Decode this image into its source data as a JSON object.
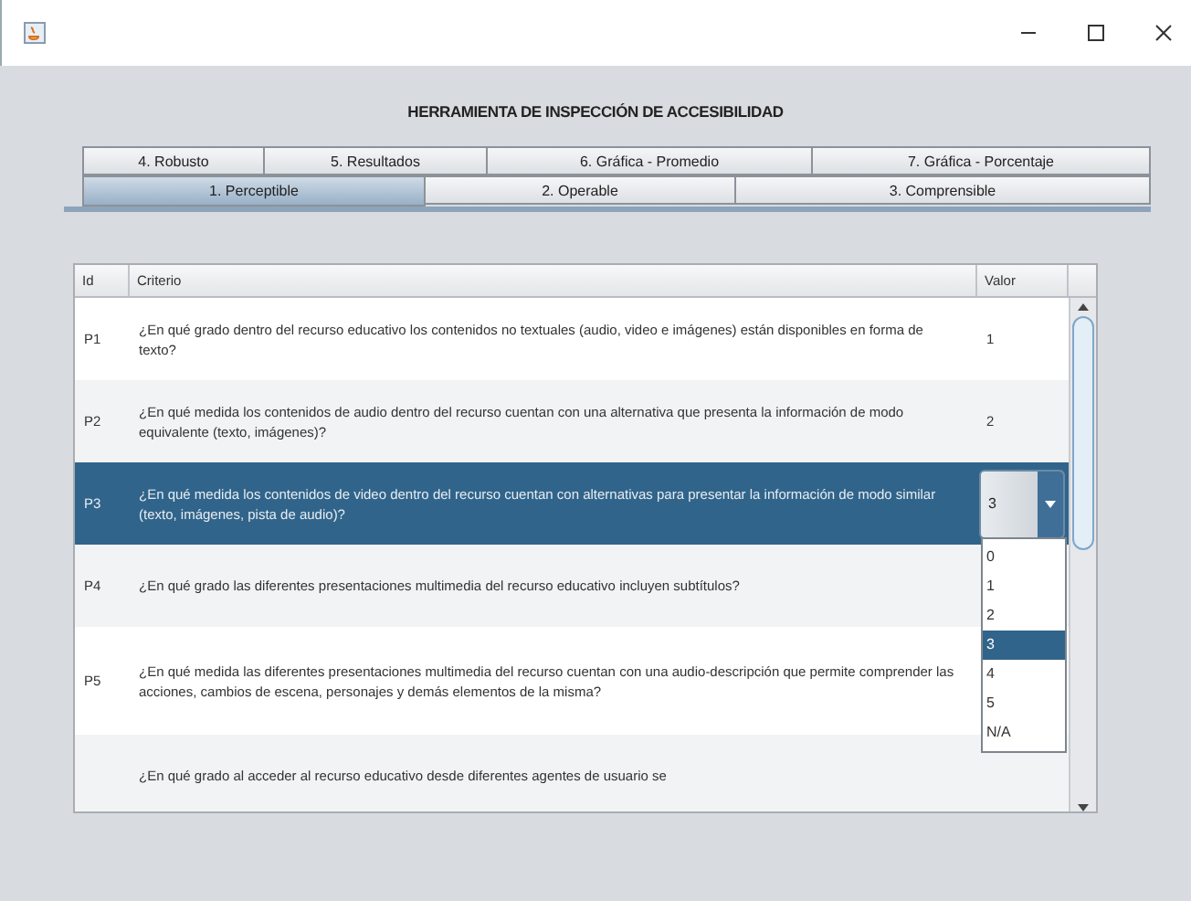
{
  "window": {
    "title": "HERRAMIENTA DE INSPECCIÓN DE ACCESIBILIDAD"
  },
  "tab_rows": [
    [
      {
        "label": "4. Robusto",
        "selected": false
      },
      {
        "label": "5. Resultados",
        "selected": false
      },
      {
        "label": "6. Gráfica - Promedio",
        "selected": false
      },
      {
        "label": "7. Gráfica - Porcentaje",
        "selected": false
      }
    ],
    [
      {
        "label": "1. Perceptible",
        "selected": true
      },
      {
        "label": "2. Operable",
        "selected": false
      },
      {
        "label": "3. Comprensible",
        "selected": false
      }
    ]
  ],
  "table": {
    "columns": [
      "Id",
      "Criterio",
      "Valor"
    ],
    "rows": [
      {
        "id": "P1",
        "criterio": "¿En qué grado dentro del recurso educativo los contenidos no textuales (audio, video e imágenes) están disponibles en forma de texto?",
        "valor": "1",
        "selected": false
      },
      {
        "id": "P2",
        "criterio": "¿En qué medida los contenidos de audio dentro del recurso cuentan con una alternativa que presenta la información de modo equivalente (texto, imágenes)?",
        "valor": "2",
        "selected": false
      },
      {
        "id": "P3",
        "criterio": "¿En qué medida los contenidos de video dentro del recurso cuentan con alternativas para presentar la información de modo similar (texto, imágenes, pista de audio)?",
        "valor": "3",
        "selected": true
      },
      {
        "id": "P4",
        "criterio": "¿En qué grado las diferentes presentaciones multimedia del recurso educativo incluyen subtítulos?",
        "selected": false
      },
      {
        "id": "P5",
        "criterio": "¿En qué medida las diferentes presentaciones multimedia del recurso cuentan con una audio-descripción que permite comprender las acciones, cambios de escena, personajes y demás elementos de la misma?",
        "selected": false
      },
      {
        "criterio": "¿En qué grado al acceder al recurso educativo desde diferentes agentes de usuario se",
        "selected": false
      }
    ]
  },
  "dropdown": {
    "options": [
      {
        "label": "0",
        "selected": false
      },
      {
        "label": "1",
        "selected": false
      },
      {
        "label": "2",
        "selected": false
      },
      {
        "label": "3",
        "selected": true
      },
      {
        "label": "4",
        "selected": false
      },
      {
        "label": "5",
        "selected": false
      },
      {
        "label": "N/A",
        "selected": false
      }
    ]
  }
}
